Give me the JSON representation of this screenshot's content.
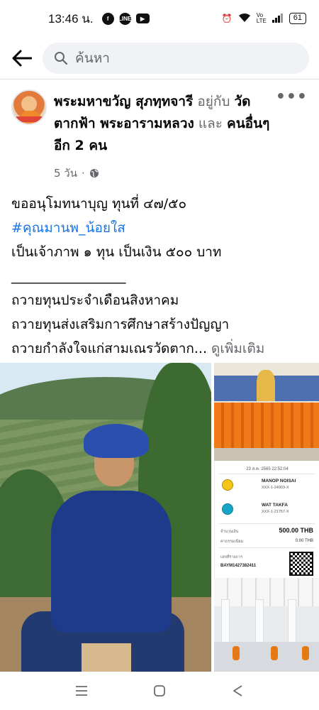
{
  "status_bar": {
    "time": "13:46 น.",
    "apps": [
      "facebook-icon",
      "line-icon",
      "youtube-icon"
    ],
    "network": "Vo LTE",
    "battery": "61"
  },
  "search": {
    "placeholder": "ค้นหา"
  },
  "post": {
    "author": "พระมหาขวัญ สุภทฺทจารี",
    "with_word": "อยู่กับ",
    "tagged_place": "วัดตากฟ้า พระอารามหลวง",
    "and_word": "และ",
    "others": "คนอื่นๆ อีก 2 คน",
    "time": "5 วัน",
    "privacy_separator": "·",
    "lines": [
      "ขออนุโมทนาบุญ ทุนที่ ๔๗/๕๐",
      "#คุณมานพ_น้อยใส",
      "เป็นเจ้าภาพ ๑ ทุน เป็นเงิน ๕๐๐ บาท",
      "_________________",
      "ถวายทุนประจำเดือนสิงหาคม",
      "ถวายทุนส่งเสริมการศึกษาสร้างปัญญา",
      "ถวายกำลังใจแก่สามเณรวัดตาก..."
    ],
    "see_more": "ดูเพิ่มเติม"
  },
  "receipt": {
    "date": "23 ส.ค. 2565 22:52:04",
    "from_name": "MANOP NOISAI",
    "from_account": "XXX-1-24903-X",
    "to_name": "WAT TAKFA",
    "to_account": "XXX-1-21757-X",
    "amount_label": "จำนวนเงิน",
    "amount": "500.00 THB",
    "fee_label": "ค่าธรรมเนียม",
    "fee": "0.00 THB",
    "ref_label": "เลขที่รายการ",
    "ref": "BAYM1427382411"
  },
  "colors": {
    "link": "#1b74e4",
    "secondary": "#65676b",
    "background": "#ffffff"
  }
}
